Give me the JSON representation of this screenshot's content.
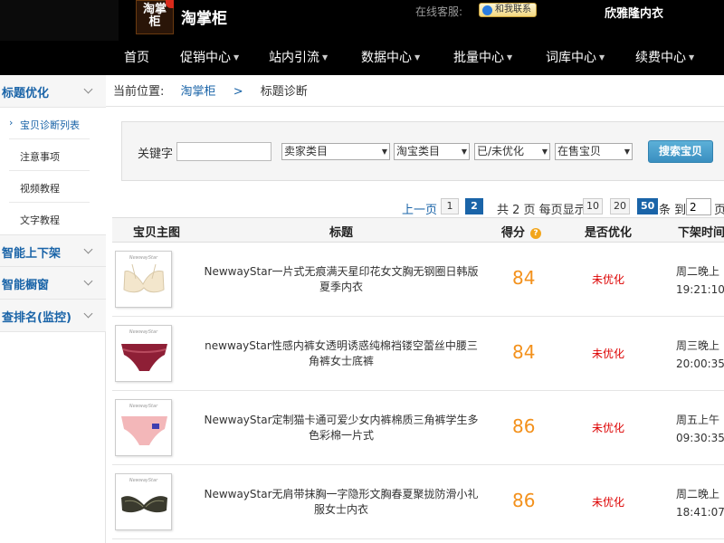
{
  "header": {
    "logo_text": "淘掌柜",
    "brand": "淘掌柜",
    "service_label": "在线客服:",
    "contact_button": "和我联系",
    "store_name": "欣雅隆内衣"
  },
  "nav": [
    {
      "label": "首页",
      "dropdown": false
    },
    {
      "label": "促销中心",
      "dropdown": true
    },
    {
      "label": "站内引流",
      "dropdown": true
    },
    {
      "label": "数据中心",
      "dropdown": true
    },
    {
      "label": "批量中心",
      "dropdown": true
    },
    {
      "label": "词库中心",
      "dropdown": true
    },
    {
      "label": "续费中心",
      "dropdown": true
    }
  ],
  "sidebar": {
    "groups": [
      {
        "label": "标题优化"
      },
      {
        "label": "智能上下架"
      },
      {
        "label": "智能橱窗"
      },
      {
        "label": "查排名(监控)"
      }
    ],
    "sub_items": [
      {
        "label": "宝贝诊断列表"
      },
      {
        "label": "注意事项"
      },
      {
        "label": "视频教程"
      },
      {
        "label": "文字教程"
      }
    ]
  },
  "breadcrumb": {
    "prefix": "当前位置:",
    "home": "淘掌柜",
    "separator": ">",
    "current": "标题诊断"
  },
  "filter": {
    "keyword_label": "关键字",
    "keyword_value": "",
    "select_seller_cat": "卖家类目",
    "select_taobao_cat": "淘宝类目",
    "select_optimized": "已/未优化",
    "select_status": "在售宝贝",
    "search_button": "搜索宝贝"
  },
  "pagination": {
    "prev": "上一页",
    "pages": [
      "1",
      "2"
    ],
    "current_page": "2",
    "total_text": "共 2 页 每页显示",
    "size_options": [
      "10",
      "20",
      "50"
    ],
    "current_size": "50",
    "per_text": "条 到",
    "goto_value": "2",
    "goto_suffix": "页"
  },
  "table": {
    "headers": {
      "image": "宝贝主图",
      "title": "标题",
      "score": "得分",
      "optimized": "是否优化",
      "off_shelf": "下架时间"
    },
    "rows": [
      {
        "title": "NewwayStar一片式无痕满天星印花女文胸无钢圈日韩版夏季内衣",
        "score": "84",
        "optimized": "未优化",
        "off_day": "周二晚上",
        "off_time": "19:21:10",
        "thumb_color": "#f3e6cc",
        "thumb_icon": "bra-icon"
      },
      {
        "title": "newwayStar性感内裤女透明诱惑纯棉裆镂空蕾丝中腰三角裤女士底裤",
        "score": "84",
        "optimized": "未优化",
        "off_day": "周三晚上",
        "off_time": "20:00:35",
        "thumb_color": "#8e1f36",
        "thumb_icon": "panty-icon"
      },
      {
        "title": "NewwayStar定制猫卡通可爱少女内裤棉质三角裤学生多色彩棉一片式",
        "score": "86",
        "optimized": "未优化",
        "off_day": "周五上午",
        "off_time": "09:30:35",
        "thumb_color": "#f3b7b9",
        "thumb_icon": "panty-icon"
      },
      {
        "title": "NewwayStar无肩带抹胸一字隐形文胸春夏聚拢防滑小礼服女士内衣",
        "score": "86",
        "optimized": "未优化",
        "off_day": "周二晚上",
        "off_time": "18:41:07",
        "thumb_color": "#3a3a2e",
        "thumb_icon": "bra-icon"
      }
    ]
  }
}
